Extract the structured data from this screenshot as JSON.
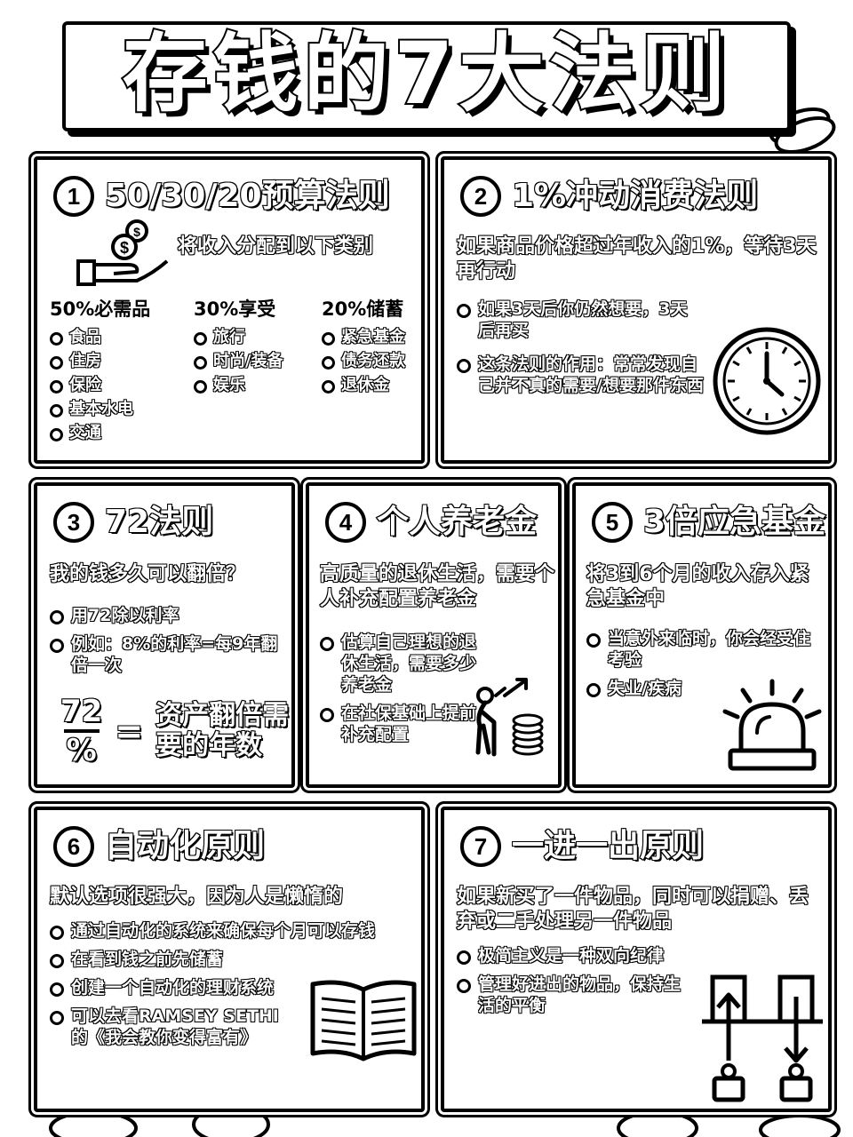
{
  "title": "存钱的7大法则",
  "cards": [
    {
      "num": "1",
      "title": "50/30/20预算法则",
      "lead": "将收入分配到以下类别",
      "columns": [
        {
          "head": "50%必需品",
          "items": [
            "食品",
            "住房",
            "保险",
            "基本水电",
            "交通"
          ]
        },
        {
          "head": "30%享受",
          "items": [
            "旅行",
            "时尚/装备",
            "娱乐"
          ]
        },
        {
          "head": "20%储蓄",
          "items": [
            "紧急基金",
            "债务还款",
            "退休金"
          ]
        }
      ],
      "icon": "hand-coins-icon"
    },
    {
      "num": "2",
      "title": "1%冲动消费法则",
      "lead": "如果商品价格超过年收入的1%，等待3天再行动",
      "bullets": [
        "如果3天后你仍然想要，3天后再买",
        "这条法则的作用：常常发现自己并不真的需要/想要那件东西"
      ],
      "icon": "clock-icon"
    },
    {
      "num": "3",
      "title": "72法则",
      "lead": "我的钱多久可以翻倍？",
      "bullets": [
        "用72除以利率",
        "例如：8%的利率=每9年翻倍一次"
      ],
      "formula": {
        "numerator": "72",
        "denominator": "%",
        "equals": "=",
        "result": "资产翻倍需要的年数"
      }
    },
    {
      "num": "4",
      "title": "个人养老金",
      "lead": "高质量的退休生活，需要个人补充配置养老金",
      "bullets": [
        "估算自己理想的退休生活，需要多少养老金",
        "在社保基础上提前补充配置"
      ],
      "icon": "elder-growth-icon"
    },
    {
      "num": "5",
      "title": "3倍应急基金",
      "lead": "将3到6个月的收入存入紧急基金中",
      "bullets": [
        "当意外来临时，你会经受住考验",
        "失业/疾病"
      ],
      "icon": "alarm-icon"
    },
    {
      "num": "6",
      "title": "自动化原则",
      "lead": "默认选项很强大，因为人是懒惰的",
      "bullets": [
        "通过自动化的系统来确保每个月可以存钱",
        "在看到钱之前先储蓄",
        "创建一个自动化的理财系统",
        "可以去看RAMSEY SETHI的《我会教你变得富有》"
      ],
      "icon": "book-icon"
    },
    {
      "num": "7",
      "title": "一进一出原则",
      "lead": "如果新买了一件物品，同时可以捐赠、丢弃或二手处理另一件物品",
      "bullets": [
        "极简主义是一种双向纪律",
        "管理好进出的物品，保持生活的平衡"
      ],
      "icon": "in-out-icon"
    }
  ]
}
